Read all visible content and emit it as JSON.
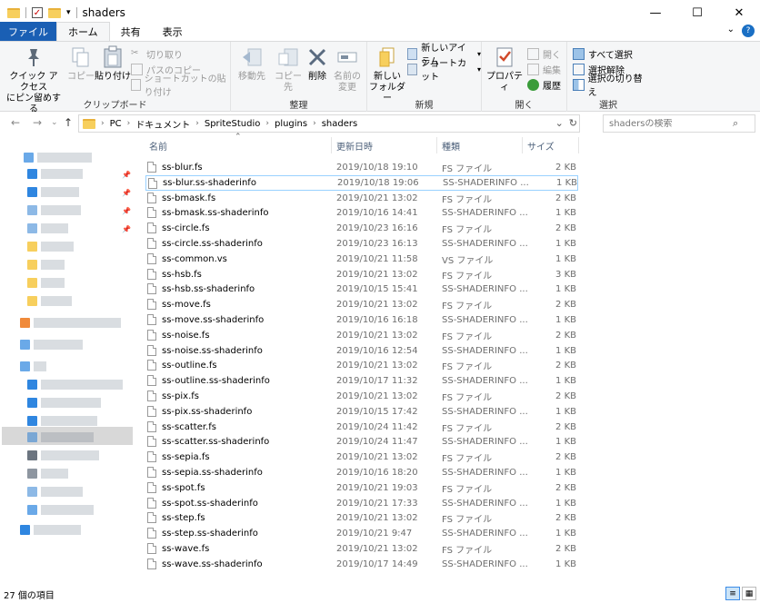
{
  "window": {
    "title": "shaders"
  },
  "ribbon_tabs": [
    {
      "label": "ファイル"
    },
    {
      "label": "ホーム"
    },
    {
      "label": "共有"
    },
    {
      "label": "表示"
    }
  ],
  "clipboard": {
    "pin_label_1": "クイック アクセス",
    "pin_label_2": "にピン留めする",
    "copy": "コピー",
    "paste": "貼り付け",
    "cut": "切り取り",
    "copy_path": "パスのコピー",
    "paste_shortcut": "ショートカットの貼り付け",
    "group_label": "クリップボード"
  },
  "organize": {
    "move_to": "移動先",
    "copy_to": "コピー先",
    "delete": "削除",
    "rename_1": "名前の",
    "rename_2": "変更",
    "group_label": "整理"
  },
  "new_group": {
    "new_folder_1": "新しい",
    "new_folder_2": "フォルダー",
    "new_item": "新しいアイテム",
    "shortcut": "ショートカット",
    "group_label": "新規"
  },
  "open_group": {
    "properties": "プロパティ",
    "open": "開く",
    "edit": "編集",
    "history": "履歴",
    "group_label": "開く"
  },
  "select_group": {
    "select_all": "すべて選択",
    "select_none": "選択解除",
    "invert": "選択の切り替え",
    "group_label": "選択"
  },
  "address": {
    "crumbs": [
      "PC",
      "ドキュメント",
      "SpriteStudio",
      "plugins",
      "shaders"
    ]
  },
  "search": {
    "placeholder": "shadersの検索"
  },
  "columns": {
    "name": "名前",
    "date": "更新日時",
    "type": "種類",
    "size": "サイズ"
  },
  "files": [
    {
      "name": "ss-blur.fs",
      "date": "2019/10/18 19:10",
      "type": "FS ファイル",
      "size": "2 KB"
    },
    {
      "name": "ss-blur.ss-shaderinfo",
      "date": "2019/10/18 19:06",
      "type": "SS-SHADERINFO ...",
      "size": "1 KB"
    },
    {
      "name": "ss-bmask.fs",
      "date": "2019/10/21 13:02",
      "type": "FS ファイル",
      "size": "2 KB"
    },
    {
      "name": "ss-bmask.ss-shaderinfo",
      "date": "2019/10/16 14:41",
      "type": "SS-SHADERINFO ...",
      "size": "1 KB"
    },
    {
      "name": "ss-circle.fs",
      "date": "2019/10/23 16:16",
      "type": "FS ファイル",
      "size": "2 KB"
    },
    {
      "name": "ss-circle.ss-shaderinfo",
      "date": "2019/10/23 16:13",
      "type": "SS-SHADERINFO ...",
      "size": "1 KB"
    },
    {
      "name": "ss-common.vs",
      "date": "2019/10/21 11:58",
      "type": "VS ファイル",
      "size": "1 KB"
    },
    {
      "name": "ss-hsb.fs",
      "date": "2019/10/21 13:02",
      "type": "FS ファイル",
      "size": "3 KB"
    },
    {
      "name": "ss-hsb.ss-shaderinfo",
      "date": "2019/10/15 15:41",
      "type": "SS-SHADERINFO ...",
      "size": "1 KB"
    },
    {
      "name": "ss-move.fs",
      "date": "2019/10/21 13:02",
      "type": "FS ファイル",
      "size": "2 KB"
    },
    {
      "name": "ss-move.ss-shaderinfo",
      "date": "2019/10/16 16:18",
      "type": "SS-SHADERINFO ...",
      "size": "1 KB"
    },
    {
      "name": "ss-noise.fs",
      "date": "2019/10/21 13:02",
      "type": "FS ファイル",
      "size": "2 KB"
    },
    {
      "name": "ss-noise.ss-shaderinfo",
      "date": "2019/10/16 12:54",
      "type": "SS-SHADERINFO ...",
      "size": "1 KB"
    },
    {
      "name": "ss-outline.fs",
      "date": "2019/10/21 13:02",
      "type": "FS ファイル",
      "size": "2 KB"
    },
    {
      "name": "ss-outline.ss-shaderinfo",
      "date": "2019/10/17 11:32",
      "type": "SS-SHADERINFO ...",
      "size": "1 KB"
    },
    {
      "name": "ss-pix.fs",
      "date": "2019/10/21 13:02",
      "type": "FS ファイル",
      "size": "2 KB"
    },
    {
      "name": "ss-pix.ss-shaderinfo",
      "date": "2019/10/15 17:42",
      "type": "SS-SHADERINFO ...",
      "size": "1 KB"
    },
    {
      "name": "ss-scatter.fs",
      "date": "2019/10/24 11:42",
      "type": "FS ファイル",
      "size": "2 KB"
    },
    {
      "name": "ss-scatter.ss-shaderinfo",
      "date": "2019/10/24 11:47",
      "type": "SS-SHADERINFO ...",
      "size": "1 KB"
    },
    {
      "name": "ss-sepia.fs",
      "date": "2019/10/21 13:02",
      "type": "FS ファイル",
      "size": "2 KB"
    },
    {
      "name": "ss-sepia.ss-shaderinfo",
      "date": "2019/10/16 18:20",
      "type": "SS-SHADERINFO ...",
      "size": "1 KB"
    },
    {
      "name": "ss-spot.fs",
      "date": "2019/10/21 19:03",
      "type": "FS ファイル",
      "size": "2 KB"
    },
    {
      "name": "ss-spot.ss-shaderinfo",
      "date": "2019/10/21 17:33",
      "type": "SS-SHADERINFO ...",
      "size": "1 KB"
    },
    {
      "name": "ss-step.fs",
      "date": "2019/10/21 13:02",
      "type": "FS ファイル",
      "size": "2 KB"
    },
    {
      "name": "ss-step.ss-shaderinfo",
      "date": "2019/10/21 9:47",
      "type": "SS-SHADERINFO ...",
      "size": "1 KB"
    },
    {
      "name": "ss-wave.fs",
      "date": "2019/10/21 13:02",
      "type": "FS ファイル",
      "size": "2 KB"
    },
    {
      "name": "ss-wave.ss-shaderinfo",
      "date": "2019/10/17 14:49",
      "type": "SS-SHADERINFO ...",
      "size": "1 KB"
    }
  ],
  "status": {
    "item_count": "27 個の項目"
  },
  "colors": {
    "file_tab": "#1a5fb4",
    "folder": "#f7cf5d",
    "selection_border": "#99d1ff",
    "header_text": "#4c607a"
  }
}
